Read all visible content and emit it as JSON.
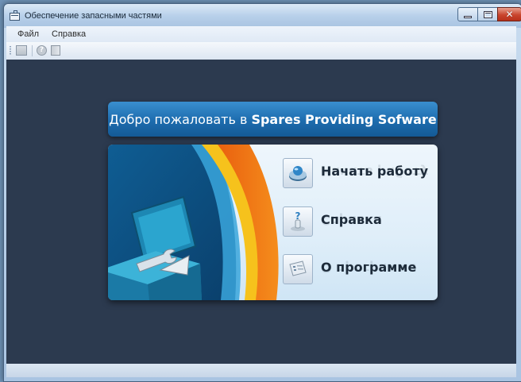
{
  "window": {
    "title": "Обеспечение запасными частями",
    "controls": [
      "minimize",
      "maximize",
      "close"
    ],
    "close_glyph": "✕"
  },
  "menubar": {
    "items": [
      "Файл",
      "Справка"
    ]
  },
  "toolbar": {
    "icons": [
      "save-icon",
      "help-icon",
      "book-icon"
    ],
    "help_glyph": "?"
  },
  "welcome": {
    "prefix": "Добро пожаловать в",
    "product": "Spares Providing Sofware"
  },
  "entries": [
    {
      "label": "Начать работу",
      "icon": "disk-globe-icon"
    },
    {
      "label": "Справка",
      "icon": "help-figure-icon"
    },
    {
      "label": "О программе",
      "icon": "document-list-icon"
    }
  ],
  "colors": {
    "background": "#2c3a4f",
    "header_blue": "#1d6cae",
    "swoosh_orange": "#f07a12",
    "swoosh_yellow": "#f6c21c",
    "toolbox_teal": "#2aa0c4"
  }
}
